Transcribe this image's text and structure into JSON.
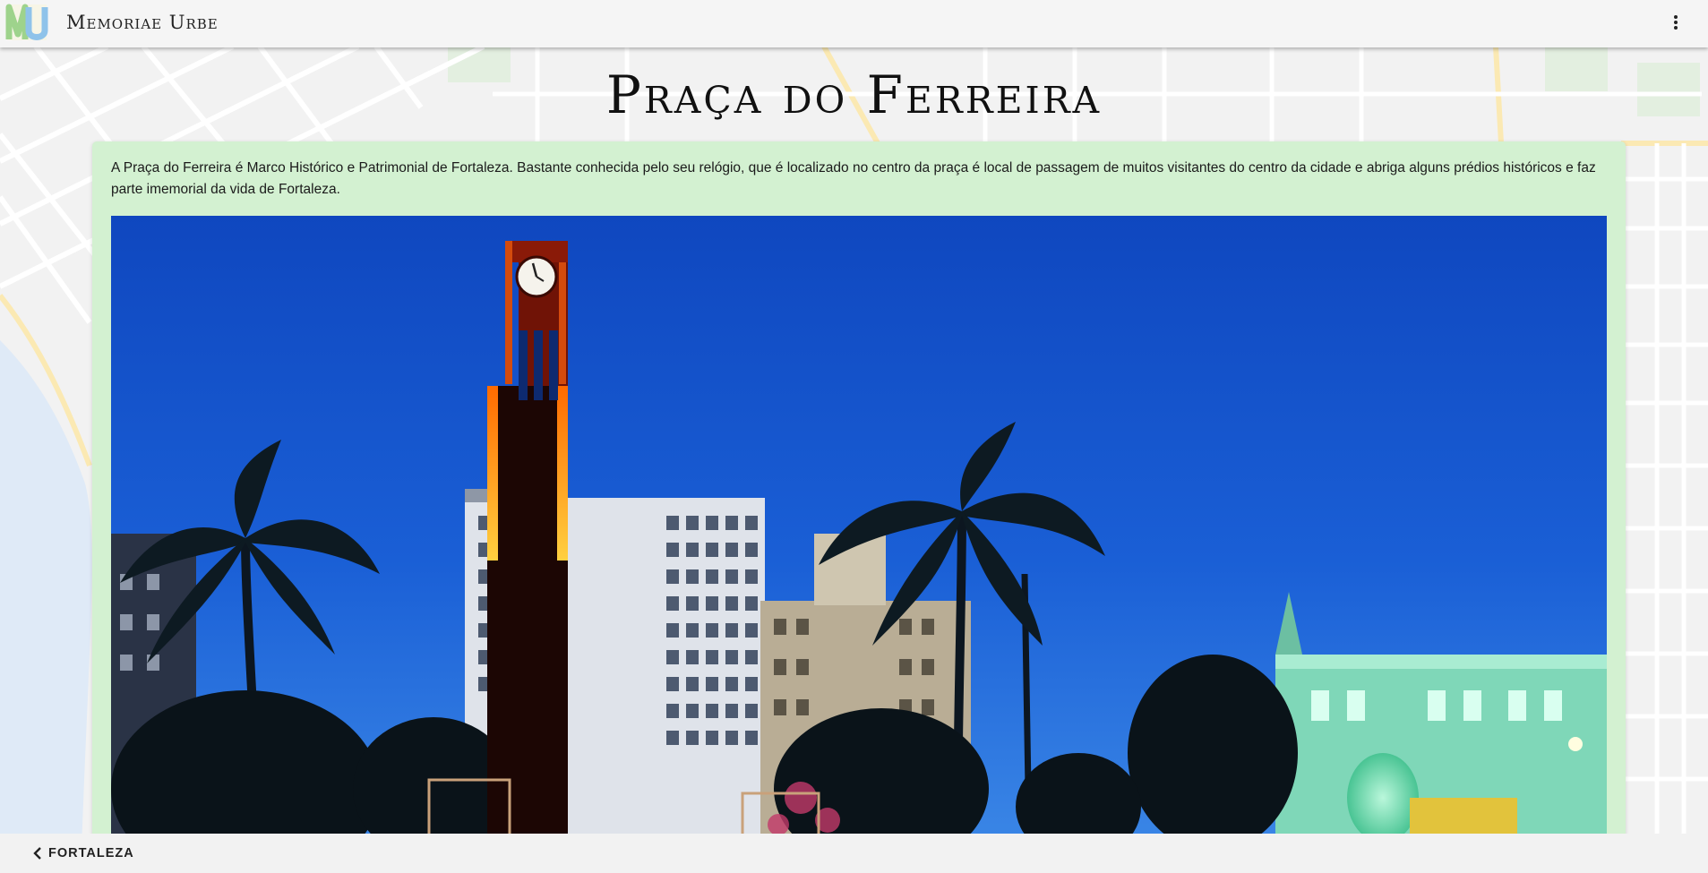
{
  "app": {
    "title": "Memoriae Urbe"
  },
  "page": {
    "title": "Praça do Ferreira",
    "description": "A Praça do Ferreira é Marco Histórico e Patrimonial de Fortaleza. Bastante conhecida pelo seu relógio, que é localizado no centro da praça é local de passagem de muitos visitantes do centro da cidade e abriga alguns prédios históricos e faz parte imemorial da vida de Fortaleza."
  },
  "navigation": {
    "back_label": "FORTALEZA"
  },
  "icons": {
    "logo": "memoriae-urbe-logo",
    "menu": "more-vert-icon",
    "back": "chevron-left-icon"
  },
  "colors": {
    "app_bar": "#f5f5f5",
    "card_background": "#d3f1d1",
    "sky": "#1556c8",
    "map_background": "#f3f3f3"
  }
}
